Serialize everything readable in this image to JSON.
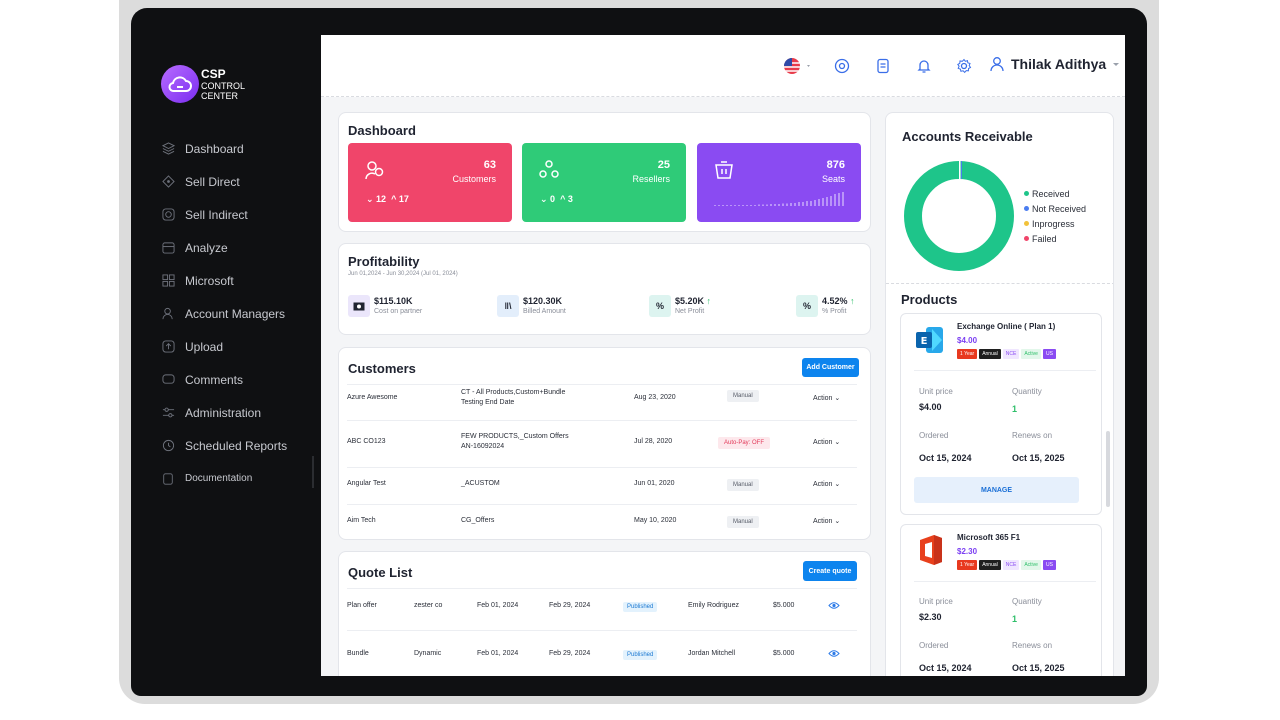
{
  "brand": {
    "line1": "CSP",
    "line2": "CONTROL",
    "line3": "CENTER"
  },
  "sidebar": {
    "items": [
      {
        "label": "Dashboard",
        "icon": "layers-icon"
      },
      {
        "label": "Sell Direct",
        "icon": "tag-icon"
      },
      {
        "label": "Sell Indirect",
        "icon": "target-icon"
      },
      {
        "label": "Analyze",
        "icon": "calendar-icon"
      },
      {
        "label": "Microsoft",
        "icon": "grid-icon"
      },
      {
        "label": "Account Managers",
        "icon": "user-icon"
      },
      {
        "label": "Upload",
        "icon": "upload-icon"
      },
      {
        "label": "Comments",
        "icon": "comment-icon"
      },
      {
        "label": "Administration",
        "icon": "sliders-icon"
      },
      {
        "label": "Scheduled Reports",
        "icon": "clock-icon"
      },
      {
        "label": "Documentation",
        "icon": "document-icon"
      }
    ]
  },
  "topbar": {
    "user": "Thilak Adithya"
  },
  "dashboard": {
    "title": "Dashboard",
    "stats": [
      {
        "value": "63",
        "label": "Customers",
        "down": "12",
        "up": "17",
        "color": "#f0456a"
      },
      {
        "value": "25",
        "label": "Resellers",
        "down": "0",
        "up": "3",
        "color": "#2fcb78"
      },
      {
        "value": "876",
        "label": "Seats",
        "color": "#8a4bf2"
      }
    ]
  },
  "profitability": {
    "title": "Profitability",
    "range": "Jun 01,2024 - Jun 30,2024 (Jul 01, 2024)",
    "items": [
      {
        "value": "$115.10K",
        "label": "Cost on partner"
      },
      {
        "value": "$120.30K",
        "label": "Billed Amount"
      },
      {
        "value": "$5.20K",
        "label": "Net Profit"
      },
      {
        "value": "4.52%",
        "label": "% Profit"
      }
    ]
  },
  "customers": {
    "title": "Customers",
    "add_label": "Add Customer",
    "action_label": "Action",
    "rows": [
      {
        "name": "Azure Awesome",
        "plan1": "CT - All Products,Custom+Bundle",
        "plan2": "Testing End Date",
        "date": "Aug 23, 2020",
        "status": "Manual"
      },
      {
        "name": "ABC CO123",
        "plan1": "FEW PRODUCTS,_Custom Offers",
        "plan2": "AN-16092024",
        "date": "Jul 28, 2020",
        "status": "Auto-Pay: OFF"
      },
      {
        "name": "Angular Test",
        "plan1": "_ACUSTOM",
        "plan2": "",
        "date": "Jun 01, 2020",
        "status": "Manual"
      },
      {
        "name": "Aim Tech",
        "plan1": "CG_Offers",
        "plan2": "",
        "date": "May 10, 2020",
        "status": "Manual"
      }
    ]
  },
  "quotes": {
    "title": "Quote List",
    "create_label": "Create quote",
    "rows": [
      {
        "name": "Plan offer",
        "customer": "zester co",
        "start": "Feb 01, 2024",
        "end": "Feb 29, 2024",
        "status": "Published",
        "owner": "Emily Rodriguez",
        "amount": "$5.000"
      },
      {
        "name": "Bundle",
        "customer": "Dynamic",
        "start": "Feb 01, 2024",
        "end": "Feb 29, 2024",
        "status": "Published",
        "owner": "Jordan Mitchell",
        "amount": "$5.000"
      }
    ]
  },
  "receivable": {
    "title": "Accounts Receivable",
    "legend": [
      {
        "label": "Received",
        "color": "#1ec58a"
      },
      {
        "label": "Not Received",
        "color": "#4a7df0"
      },
      {
        "label": "Inprogress",
        "color": "#f2c23a"
      },
      {
        "label": "Failed",
        "color": "#f0456a"
      }
    ]
  },
  "products": {
    "title": "Products",
    "labels": {
      "unit": "Unit price",
      "qty": "Quantity",
      "ordered": "Ordered",
      "renews": "Renews on",
      "manage": "MANAGE"
    },
    "items": [
      {
        "name": "Exchange Online ( Plan 1)",
        "price": "$4.00",
        "unit": "$4.00",
        "qty": "1",
        "ordered": "Oct 15, 2024",
        "renews": "Oct 15, 2025",
        "tags": [
          "1 Year",
          "Annual",
          "NCE",
          "Active",
          "US"
        ]
      },
      {
        "name": "Microsoft 365 F1",
        "price": "$2.30",
        "unit": "$2.30",
        "qty": "1",
        "ordered": "Oct 15, 2024",
        "renews": "Oct 15, 2025",
        "tags": [
          "1 Year",
          "Annual",
          "NCE",
          "Active",
          "US"
        ]
      }
    ]
  }
}
